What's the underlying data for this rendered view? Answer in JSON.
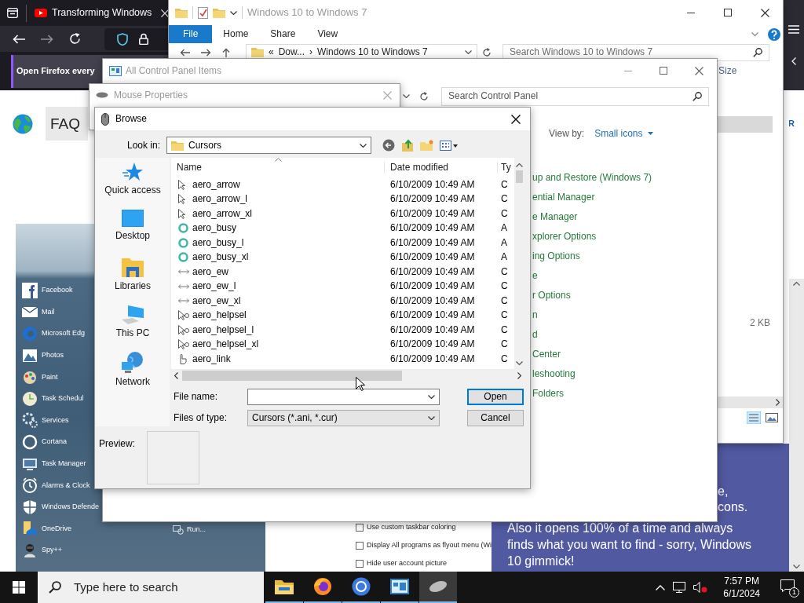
{
  "browser": {
    "tab_title": "Transforming Windows",
    "notification": "Open Firefox every",
    "page": {
      "faq_tab": "FAQ",
      "edge_letter": "R",
      "start_menu": {
        "items": [
          {
            "label": "Facebook",
            "kind": "facebook"
          },
          {
            "label": "Mail",
            "kind": "mail"
          },
          {
            "label": "Microsoft Edg",
            "kind": "edge"
          },
          {
            "label": "Photos",
            "kind": "photos"
          },
          {
            "label": "Paint",
            "kind": "paint"
          },
          {
            "label": "Task Schedul",
            "kind": "clock"
          },
          {
            "label": "Services",
            "kind": "gear"
          },
          {
            "label": "Cortana",
            "kind": "ring"
          },
          {
            "label": "Task Manager",
            "kind": "monitor"
          },
          {
            "label": "Alarms & Clock",
            "kind": "alarm"
          },
          {
            "label": "Windows Defende",
            "kind": "shield"
          },
          {
            "label": "OneDrive",
            "kind": "cloud"
          },
          {
            "label": "Spy++",
            "kind": "spy"
          }
        ],
        "run": "Run..."
      },
      "settings": [
        {
          "label": "Use custom taskbar coloring",
          "checked": false
        },
        {
          "label": "Display All programs as flyout menu (Wi",
          "checked": false
        },
        {
          "label": "Hide user account picture",
          "checked": false
        }
      ],
      "promo": {
        "fragments": [
          "e,",
          "cons."
        ],
        "text": "Also it opens 100% of a time and always finds what you want to find - sorry, Windows 10 gimmick!"
      }
    }
  },
  "explorer": {
    "title": "Windows 10 to Windows 7",
    "ribbon_tabs": [
      {
        "label": "File",
        "kind": "file_menu"
      },
      {
        "label": "Home",
        "kind": "tab"
      },
      {
        "label": "Share",
        "kind": "tab"
      },
      {
        "label": "View",
        "kind": "tab"
      }
    ],
    "breadcrumb": [
      "«",
      "Dow...",
      "›",
      "Windows 10 to Windows 7"
    ],
    "search": {
      "placeholder": "Search Windows 10 to Windows 7"
    },
    "column_header": "Size",
    "cell": "2 KB"
  },
  "control_panel": {
    "title": "All Control Panel Items",
    "search": {
      "placeholder": "Search Control Panel"
    },
    "view_by": {
      "label": "View by:",
      "value": "Small icons"
    },
    "items": [
      "up and Restore (Windows 7)",
      "ential Manager",
      "e Manager",
      "xplorer Options",
      "ing Options",
      "e",
      "r Options",
      "n",
      "d",
      "Center",
      "leshooting",
      "Folders"
    ]
  },
  "mouse_properties": {
    "title": "Mouse Properties"
  },
  "browse": {
    "title": "Browse",
    "look_in": {
      "label": "Look in:",
      "value": "Cursors"
    },
    "places": [
      {
        "label": "Quick access",
        "kind": "star"
      },
      {
        "label": "Desktop",
        "kind": "desktop"
      },
      {
        "label": "Libraries",
        "kind": "libraries"
      },
      {
        "label": "This PC",
        "kind": "pc"
      },
      {
        "label": "Network",
        "kind": "network"
      }
    ],
    "columns": [
      "Name",
      "Date modified",
      "Ty"
    ],
    "rows": [
      {
        "name": "aero_arrow",
        "date": "6/10/2009 10:49 AM",
        "type": "C",
        "kind": "arrow"
      },
      {
        "name": "aero_arrow_l",
        "date": "6/10/2009 10:49 AM",
        "type": "C",
        "kind": "arrow"
      },
      {
        "name": "aero_arrow_xl",
        "date": "6/10/2009 10:49 AM",
        "type": "C",
        "kind": "arrow"
      },
      {
        "name": "aero_busy",
        "date": "6/10/2009 10:49 AM",
        "type": "A",
        "kind": "busy"
      },
      {
        "name": "aero_busy_l",
        "date": "6/10/2009 10:49 AM",
        "type": "A",
        "kind": "busy"
      },
      {
        "name": "aero_busy_xl",
        "date": "6/10/2009 10:49 AM",
        "type": "A",
        "kind": "busy"
      },
      {
        "name": "aero_ew",
        "date": "6/10/2009 10:49 AM",
        "type": "C",
        "kind": "ew"
      },
      {
        "name": "aero_ew_l",
        "date": "6/10/2009 10:49 AM",
        "type": "C",
        "kind": "ew"
      },
      {
        "name": "aero_ew_xl",
        "date": "6/10/2009 10:49 AM",
        "type": "C",
        "kind": "ew"
      },
      {
        "name": "aero_helpsel",
        "date": "6/10/2009 10:49 AM",
        "type": "C",
        "kind": "helpsel"
      },
      {
        "name": "aero_helpsel_l",
        "date": "6/10/2009 10:49 AM",
        "type": "C",
        "kind": "helpsel"
      },
      {
        "name": "aero_helpsel_xl",
        "date": "6/10/2009 10:49 AM",
        "type": "C",
        "kind": "helpsel"
      },
      {
        "name": "aero_link",
        "date": "6/10/2009 10:49 AM",
        "type": "C",
        "kind": "link"
      }
    ],
    "file_name": {
      "label": "File name:"
    },
    "file_type": {
      "label": "Files of type:",
      "value": "Cursors (*.ani, *.cur)"
    },
    "buttons": [
      {
        "label": "Open",
        "default": true
      },
      {
        "label": "Cancel",
        "default": false
      }
    ],
    "preview_label": "Preview:"
  },
  "taskbar": {
    "search": {
      "placeholder": "Type here to search"
    },
    "apps": [
      {
        "kind": "explorer",
        "selected": false
      },
      {
        "kind": "firefox",
        "selected": false
      },
      {
        "kind": "chrome",
        "selected": false
      },
      {
        "kind": "control_panel",
        "selected": false
      },
      {
        "kind": "mouse",
        "selected": true
      }
    ],
    "time": "7:57 PM",
    "date": "6/1/2024",
    "notifications": "1"
  }
}
